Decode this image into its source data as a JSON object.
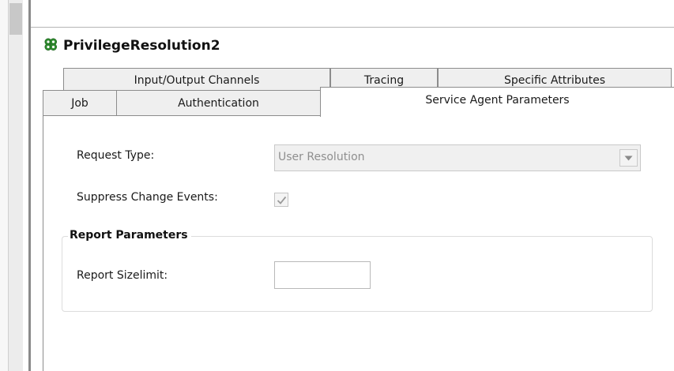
{
  "window": {
    "title": "PrivilegeResolution2",
    "icon": "gear-cluster-icon"
  },
  "tabs": {
    "row1": [
      {
        "label": "Input/Output Channels"
      },
      {
        "label": "Tracing"
      },
      {
        "label": "Specific Attributes"
      }
    ],
    "row2": [
      {
        "label": "Job"
      },
      {
        "label": "Authentication"
      },
      {
        "label": "Service Agent Parameters",
        "active": true
      }
    ]
  },
  "form": {
    "request_type_label": "Request Type:",
    "request_type_value": "User Resolution",
    "suppress_label": "Suppress Change Events:",
    "suppress_checked": true,
    "report_group_title": "Report Parameters",
    "report_sizelimit_label": "Report Sizelimit:",
    "report_sizelimit_value": ""
  },
  "colors": {
    "icon_green": "#2e8b2e",
    "border": "#8c8c8c",
    "disabled_text": "#8f8f8f"
  }
}
